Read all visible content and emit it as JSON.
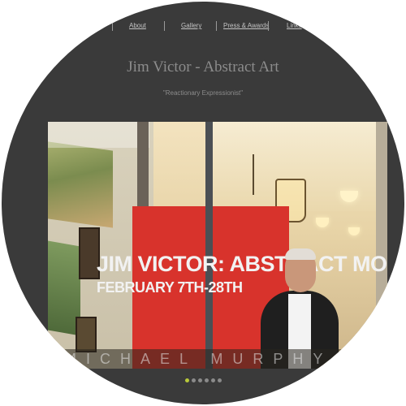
{
  "nav": {
    "items": [
      {
        "label": "About"
      },
      {
        "label": "Gallery"
      },
      {
        "label": "Press & Awards"
      },
      {
        "label": "Links"
      }
    ]
  },
  "header": {
    "title": "Jim Victor - Abstract Art",
    "tagline": "\"Reactionary Expressionist\""
  },
  "slideshow": {
    "banner_line1": "JIM VICTOR: ABSTRACT MORE",
    "banner_line2": "FEBRUARY 7TH-28TH",
    "window_lettering": "MICHAEL MURPHY",
    "current_slide": 1,
    "slide_count": 6
  },
  "colors": {
    "background": "#3a3a3a",
    "nav_text": "#c4c4c4",
    "title_text": "#8c8c8c",
    "active_dot": "#b9c93a",
    "banner_red": "#d8332c"
  }
}
